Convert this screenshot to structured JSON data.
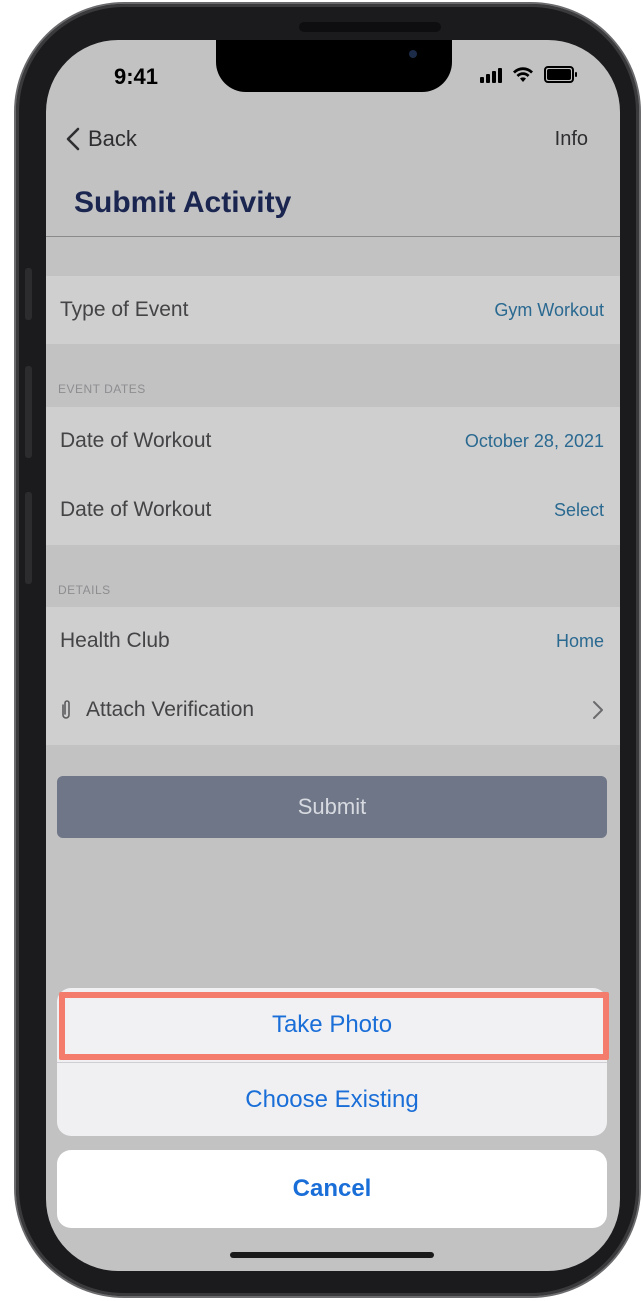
{
  "status_bar": {
    "time": "9:41"
  },
  "nav": {
    "back_label": "Back",
    "info_label": "Info"
  },
  "page_title": "Submit Activity",
  "rows": {
    "type_of_event": {
      "label": "Type of Event",
      "value": "Gym Workout"
    },
    "event_dates_header": "EVENT DATES",
    "date_start": {
      "label": "Date of Workout",
      "value": "October 28, 2021"
    },
    "date_end": {
      "label": "Date of Workout",
      "value": "Select"
    },
    "details_header": "DETAILS",
    "health_club": {
      "label": "Health Club",
      "value": "Home"
    },
    "attach": {
      "label": "Attach Verification"
    }
  },
  "submit_label": "Submit",
  "action_sheet": {
    "take_photo": "Take Photo",
    "choose_existing": "Choose Existing",
    "cancel": "Cancel"
  },
  "colors": {
    "title": "#1a2550",
    "value_link": "#2a6990",
    "action_blue": "#1a6ed8",
    "highlight": "#f47c6c",
    "submit_bg": "#6e7687"
  },
  "icons": [
    "chevron-left-icon",
    "signal-icon",
    "wifi-icon",
    "battery-icon",
    "paperclip-icon",
    "chevron-right-icon"
  ]
}
